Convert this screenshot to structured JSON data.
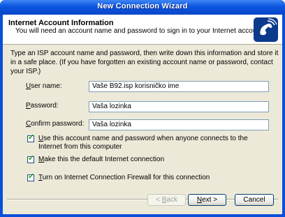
{
  "window": {
    "title": "New Connection Wizard"
  },
  "header": {
    "title": "Internet Account Information",
    "subtitle": "You will need an account name and password to sign in to your Internet account.",
    "icon": "wizard-phone-icon"
  },
  "intro": "Type an ISP account name and password, then write down this information and store it in a safe place. (If you have forgotten an existing account name or password, contact your ISP.)",
  "fields": {
    "username": {
      "label_pre": "",
      "label_u": "U",
      "label_post": "ser name:",
      "value": "Vaše B92.isp korisničko ime"
    },
    "password": {
      "label_pre": "",
      "label_u": "P",
      "label_post": "assword:",
      "value": "Vaša lozinka"
    },
    "confirm": {
      "label_pre": "",
      "label_u": "C",
      "label_post": "onfirm password:",
      "value": "Vaša lozinka"
    }
  },
  "checkboxes": {
    "use_account": {
      "checked": true,
      "pre": "",
      "u": "U",
      "post": "se this account  name and password when anyone connects to the Internet from this computer"
    },
    "default_conn": {
      "checked": true,
      "pre": "",
      "u": "M",
      "post": "ake this the default Internet connection"
    },
    "firewall": {
      "checked": true,
      "pre": "",
      "u": "T",
      "post": "urn on Internet Connection Firewall for this connection"
    }
  },
  "buttons": {
    "back": {
      "pre": "< ",
      "u": "B",
      "post": "ack"
    },
    "next": {
      "pre": "",
      "u": "N",
      "post": "ext >"
    },
    "cancel": {
      "label": "Cancel"
    }
  },
  "colors": {
    "titlebar": "#0c55e0",
    "face": "#ece9d8",
    "check": "#21a121"
  }
}
